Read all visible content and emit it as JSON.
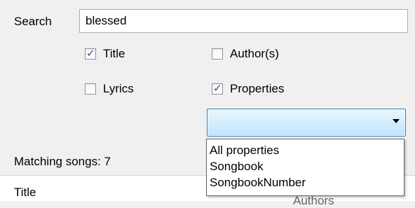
{
  "search": {
    "label": "Search",
    "value": "blessed",
    "placeholder": ""
  },
  "options": {
    "title": {
      "label": "Title",
      "checked": true
    },
    "authors": {
      "label": "Author(s)",
      "checked": false
    },
    "lyrics": {
      "label": "Lyrics",
      "checked": false
    },
    "properties": {
      "label": "Properties",
      "checked": true
    }
  },
  "property_combo": {
    "selected": "",
    "options": [
      "All properties",
      "Songbook",
      "SongbookNumber"
    ]
  },
  "results": {
    "matching_label": "Matching songs: 7"
  },
  "grid": {
    "columns": [
      "Title",
      "Authors"
    ]
  },
  "icons": {
    "check": "checkmark-icon",
    "dropdown_arrow": "chevron-down-icon"
  }
}
